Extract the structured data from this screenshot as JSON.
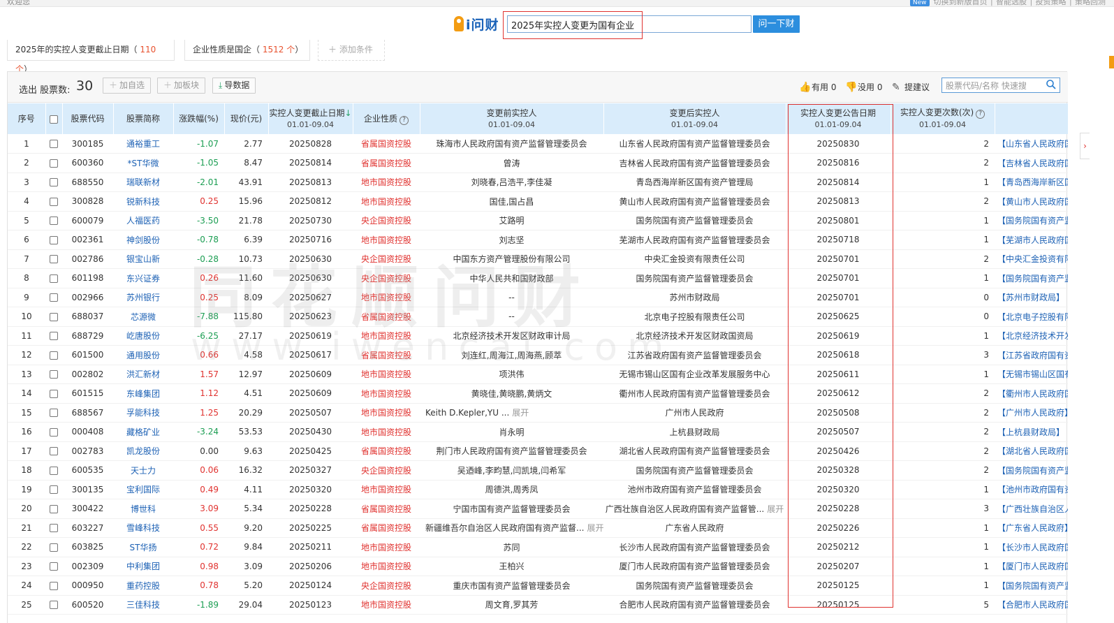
{
  "topbar": {
    "left": "欢迎您",
    "new_badge": "New",
    "right": "切换到新版首页  ∣  智能选股  ∣  投资策略  ∣  策略回测"
  },
  "header": {
    "logo": "i问财",
    "query": "2025年实控人变更为国有企业",
    "submit": "问一下财"
  },
  "conditions": [
    {
      "label": "2025年的实控人变更截止日期",
      "count": "110 个"
    },
    {
      "label": "企业性质是国企",
      "count": "1512 个"
    }
  ],
  "add_condition": "添加条件",
  "toolbar": {
    "count_label": "选出 股票数:",
    "count": "30",
    "add_watch": "加自选",
    "add_block": "加板块",
    "export": "导数据",
    "useful": "有用 0",
    "useless": "没用 0",
    "suggest": "提建议",
    "search_placeholder": "股票代码/名称 快速搜"
  },
  "columns": {
    "idx": "序号",
    "code": "股票代码",
    "name": "股票简称",
    "chg": "涨跌幅(%)",
    "price": "现价(元)",
    "end_date": "实控人变更截止日期",
    "end_date_sub": "01.01-09.04",
    "nature": "企业性质",
    "before": "变更前实控人",
    "before_sub": "01.01-09.04",
    "after": "变更后实控人",
    "after_sub": "01.01-09.04",
    "ann_date": "实控人变更公告日期",
    "ann_date_sub": "01.01-09.04",
    "times": "实控人变更次数(次)",
    "times_sub": "01.01-09.04"
  },
  "expand_label": "展开",
  "colors": {
    "up": "#e0322f",
    "down": "#1b9d52",
    "link": "#1e62b5",
    "header_bg": "#d9ecfb",
    "highlight_box": "#e0322f"
  },
  "rows": [
    {
      "idx": "1",
      "code": "300185",
      "name": "通裕重工",
      "chg": "-1.07",
      "dir": "neg",
      "price": "2.77",
      "end": "20250828",
      "nature": "省属国资控股",
      "before": "珠海市人民政府国有资产监督管理委员会",
      "before_exp": "",
      "after": "山东省人民政府国有资产监督管理委员会",
      "after_exp": "",
      "ann": "20250830",
      "times": "2",
      "extra": "【山东省人民政府国"
    },
    {
      "idx": "2",
      "code": "600360",
      "name": "*ST华微",
      "chg": "-1.05",
      "dir": "neg",
      "price": "8.47",
      "end": "20250814",
      "nature": "省属国资控股",
      "before": "曾涛",
      "before_exp": "",
      "after": "吉林省人民政府国有资产监督管理委员会",
      "after_exp": "",
      "ann": "20250816",
      "times": "2",
      "extra": "【吉林省人民政府国"
    },
    {
      "idx": "3",
      "code": "688550",
      "name": "瑞联新材",
      "chg": "-2.01",
      "dir": "neg",
      "price": "43.91",
      "end": "20250813",
      "nature": "地市国资控股",
      "before": "刘晓春,吕浩平,李佳凝",
      "before_exp": "",
      "after": "青岛西海岸新区国有资产管理局",
      "after_exp": "",
      "ann": "20250814",
      "times": "1",
      "extra": "【青岛西海岸新区国"
    },
    {
      "idx": "4",
      "code": "300828",
      "name": "锐新科技",
      "chg": "0.25",
      "dir": "pos",
      "price": "15.96",
      "end": "20250812",
      "nature": "地市国资控股",
      "before": "国佳,国占昌",
      "before_exp": "",
      "after": "黄山市人民政府国有资产监督管理委员会",
      "after_exp": "",
      "ann": "20250813",
      "times": "2",
      "extra": "【黄山市人民政府国"
    },
    {
      "idx": "5",
      "code": "600079",
      "name": "人福医药",
      "chg": "-3.50",
      "dir": "neg",
      "price": "21.78",
      "end": "20250730",
      "nature": "央企国资控股",
      "before": "艾路明",
      "before_exp": "",
      "after": "国务院国有资产监督管理委员会",
      "after_exp": "",
      "ann": "20250801",
      "times": "1",
      "extra": "【国务院国有资产监"
    },
    {
      "idx": "6",
      "code": "002361",
      "name": "神剑股份",
      "chg": "-0.78",
      "dir": "neg",
      "price": "6.39",
      "end": "20250716",
      "nature": "地市国资控股",
      "before": "刘志坚",
      "before_exp": "",
      "after": "芜湖市人民政府国有资产监督管理委员会",
      "after_exp": "",
      "ann": "20250718",
      "times": "1",
      "extra": "【芜湖市人民政府国"
    },
    {
      "idx": "7",
      "code": "002786",
      "name": "银宝山新",
      "chg": "-0.28",
      "dir": "neg",
      "price": "10.73",
      "end": "20250630",
      "nature": "央企国资控股",
      "before": "中国东方资产管理股份有限公司",
      "before_exp": "",
      "after": "中央汇金投资有限责任公司",
      "after_exp": "",
      "ann": "20250701",
      "times": "2",
      "extra": "【中央汇金投资有限"
    },
    {
      "idx": "8",
      "code": "601198",
      "name": "东兴证券",
      "chg": "0.26",
      "dir": "pos",
      "price": "11.60",
      "end": "20250630",
      "nature": "央企国资控股",
      "before": "中华人民共和国财政部",
      "before_exp": "",
      "after": "国务院国有资产监督管理委员会",
      "after_exp": "",
      "ann": "20250701",
      "times": "1",
      "extra": "【国务院国有资产监"
    },
    {
      "idx": "9",
      "code": "002966",
      "name": "苏州银行",
      "chg": "0.25",
      "dir": "pos",
      "price": "8.09",
      "end": "20250627",
      "nature": "地市国资控股",
      "before": "--",
      "before_exp": "",
      "after": "苏州市财政局",
      "after_exp": "",
      "ann": "20250701",
      "times": "0",
      "extra": "【苏州市财政局】"
    },
    {
      "idx": "10",
      "code": "688037",
      "name": "芯源微",
      "chg": "-7.88",
      "dir": "neg",
      "price": "115.80",
      "end": "20250623",
      "nature": "省属国资控股",
      "before": "--",
      "before_exp": "",
      "after": "北京电子控股有限责任公司",
      "after_exp": "",
      "ann": "20250625",
      "times": "0",
      "extra": "【北京电子控股有限"
    },
    {
      "idx": "11",
      "code": "688729",
      "name": "屹唐股份",
      "chg": "-6.25",
      "dir": "neg",
      "price": "27.17",
      "end": "20250619",
      "nature": "地市国资控股",
      "before": "北京经济技术开发区财政审计局",
      "before_exp": "",
      "after": "北京经济技术开发区财政国资局",
      "after_exp": "",
      "ann": "20250619",
      "times": "1",
      "extra": "【北京经济技术开发"
    },
    {
      "idx": "12",
      "code": "601500",
      "name": "通用股份",
      "chg": "0.66",
      "dir": "pos",
      "price": "4.58",
      "end": "20250617",
      "nature": "省属国资控股",
      "before": "刘连红,周海江,周海燕,顾萃",
      "before_exp": "",
      "after": "江苏省政府国有资产监督管理委员会",
      "after_exp": "",
      "ann": "20250618",
      "times": "3",
      "extra": "【江苏省政府国有资"
    },
    {
      "idx": "13",
      "code": "002802",
      "name": "洪汇新材",
      "chg": "1.57",
      "dir": "pos",
      "price": "12.97",
      "end": "20250609",
      "nature": "地市国资控股",
      "before": "项洪伟",
      "before_exp": "",
      "after": "无锡市锡山区国有企业改革发展服务中心",
      "after_exp": "",
      "ann": "20250611",
      "times": "1",
      "extra": "【无锡市锡山区国有"
    },
    {
      "idx": "14",
      "code": "601515",
      "name": "东峰集团",
      "chg": "1.12",
      "dir": "pos",
      "price": "4.51",
      "end": "20250609",
      "nature": "地市国资控股",
      "before": "黄晓佳,黄晓鹏,黄炳文",
      "before_exp": "",
      "after": "衢州市人民政府国有资产监督管理委员会",
      "after_exp": "",
      "ann": "20250612",
      "times": "2",
      "extra": "【衢州市人民政府国"
    },
    {
      "idx": "15",
      "code": "688567",
      "name": "孚能科技",
      "chg": "1.25",
      "dir": "pos",
      "price": "20.29",
      "end": "20250507",
      "nature": "地市国资控股",
      "before": "Keith D.Kepler,YU ...",
      "before_exp": "展开",
      "after": "广州市人民政府",
      "after_exp": "",
      "ann": "20250508",
      "times": "2",
      "extra": "【广州市人民政府】"
    },
    {
      "idx": "16",
      "code": "000408",
      "name": "藏格矿业",
      "chg": "-3.24",
      "dir": "neg",
      "price": "53.53",
      "end": "20250430",
      "nature": "地市国资控股",
      "before": "肖永明",
      "before_exp": "",
      "after": "上杭县财政局",
      "after_exp": "",
      "ann": "20250507",
      "times": "2",
      "extra": "【上杭县财政局】"
    },
    {
      "idx": "17",
      "code": "002783",
      "name": "凯龙股份",
      "chg": "0.00",
      "dir": "zero",
      "price": "9.63",
      "end": "20250425",
      "nature": "省属国资控股",
      "before": "荆门市人民政府国有资产监督管理委员会",
      "before_exp": "",
      "after": "湖北省人民政府国有资产监督管理委员会",
      "after_exp": "",
      "ann": "20250426",
      "times": "2",
      "extra": "【湖北省人民政府国"
    },
    {
      "idx": "18",
      "code": "600535",
      "name": "天士力",
      "chg": "0.06",
      "dir": "pos",
      "price": "16.32",
      "end": "20250327",
      "nature": "央企国资控股",
      "before": "吴迺峰,李畇慧,闫凯境,闫希军",
      "before_exp": "",
      "after": "国务院国有资产监督管理委员会",
      "after_exp": "",
      "ann": "20250328",
      "times": "2",
      "extra": "【国务院国有资产监"
    },
    {
      "idx": "19",
      "code": "300135",
      "name": "宝利国际",
      "chg": "0.49",
      "dir": "pos",
      "price": "4.11",
      "end": "20250320",
      "nature": "地市国资控股",
      "before": "周德洪,周秀凤",
      "before_exp": "",
      "after": "池州市政府国有资产监督管理委员会",
      "after_exp": "",
      "ann": "20250320",
      "times": "1",
      "extra": "【池州市政府国有资"
    },
    {
      "idx": "20",
      "code": "300422",
      "name": "博世科",
      "chg": "3.09",
      "dir": "pos",
      "price": "5.34",
      "end": "20250228",
      "nature": "省属国资控股",
      "before": "宁国市国有资产监督管理委员会",
      "before_exp": "",
      "after": "广西壮族自治区人民政府国有资产监督管...",
      "after_exp": "展开",
      "ann": "20250228",
      "times": "3",
      "extra": "【广西壮族自治区人"
    },
    {
      "idx": "21",
      "code": "603227",
      "name": "雪峰科技",
      "chg": "0.55",
      "dir": "pos",
      "price": "9.20",
      "end": "20250225",
      "nature": "省属国资控股",
      "before": "新疆维吾尔自治区人民政府国有资产监督...",
      "before_exp": "展开",
      "after": "广东省人民政府",
      "after_exp": "",
      "ann": "20250226",
      "times": "1",
      "extra": "【广东省人民政府】"
    },
    {
      "idx": "22",
      "code": "603825",
      "name": "ST华扬",
      "chg": "0.72",
      "dir": "pos",
      "price": "9.84",
      "end": "20250211",
      "nature": "地市国资控股",
      "before": "苏同",
      "before_exp": "",
      "after": "长沙市人民政府国有资产监督管理委员会",
      "after_exp": "",
      "ann": "20250212",
      "times": "1",
      "extra": "【长沙市人民政府国"
    },
    {
      "idx": "23",
      "code": "002309",
      "name": "中利集团",
      "chg": "0.98",
      "dir": "pos",
      "price": "3.09",
      "end": "20250206",
      "nature": "地市国资控股",
      "before": "王柏兴",
      "before_exp": "",
      "after": "厦门市人民政府国有资产监督管理委员会",
      "after_exp": "",
      "ann": "20250207",
      "times": "1",
      "extra": "【厦门市人民政府国"
    },
    {
      "idx": "24",
      "code": "000950",
      "name": "重药控股",
      "chg": "0.78",
      "dir": "pos",
      "price": "5.20",
      "end": "20250124",
      "nature": "央企国资控股",
      "before": "重庆市国有资产监督管理委员会",
      "before_exp": "",
      "after": "国务院国有资产监督管理委员会",
      "after_exp": "",
      "ann": "20250125",
      "times": "1",
      "extra": "【国务院国有资产监"
    },
    {
      "idx": "25",
      "code": "600520",
      "name": "三佳科技",
      "chg": "-1.89",
      "dir": "neg",
      "price": "29.04",
      "end": "20250123",
      "nature": "地市国资控股",
      "before": "周文育,罗其芳",
      "before_exp": "",
      "after": "合肥市人民政府国有资产监督管理委员会",
      "after_exp": "",
      "ann": "20250125",
      "times": "5",
      "extra": "【合肥市人民政府国"
    }
  ],
  "watermark": {
    "cn": "同花顺问财",
    "en": "www.iwencai.com"
  }
}
